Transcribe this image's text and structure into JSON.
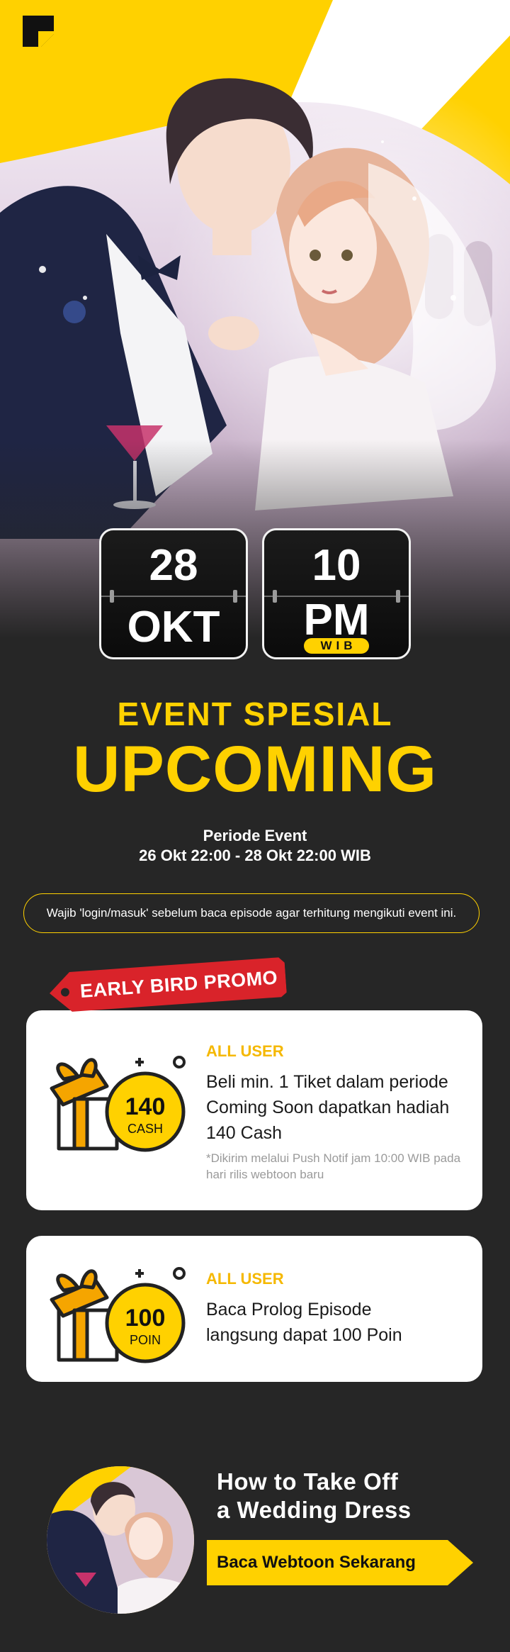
{
  "hero": {
    "logo": "webtoon-logo-icon",
    "date_day": "28",
    "date_month": "OKT",
    "time_hour": "10",
    "time_period": "PM",
    "time_zone": "WIB"
  },
  "event": {
    "title": "EVENT SPESIAL",
    "headline": "UPCOMING",
    "period_label": "Periode Event",
    "period_range": "26 Okt 22:00 - 28 Okt 22:00 WIB",
    "notice": "Wajib 'login/masuk' sebelum baca episode agar terhitung mengikuti event ini."
  },
  "promo_tag": "EARLY BIRD PROMO",
  "rewards": [
    {
      "audience": "ALL USER",
      "badge_value": "140",
      "badge_unit": "CASH",
      "description": "Beli min. 1 Tiket dalam periode Coming Soon dapatkan hadiah 140 Cash",
      "note": "*Dikirim melalui Push Notif jam 10:00 WIB pada hari rilis webtoon baru"
    },
    {
      "audience": "ALL USER",
      "badge_value": "100",
      "badge_unit": "POIN",
      "description": "Baca Prolog Episode langsung dapat 100 Poin"
    }
  ],
  "banner": {
    "title_line1": "How to Take Off",
    "title_line2": "a Wedding Dress",
    "cta_label": "Baca Webtoon Sekarang"
  },
  "colors": {
    "accent": "#ffd100",
    "background": "#262626",
    "tag": "#d9232a",
    "gift_orange": "#f5a500"
  }
}
